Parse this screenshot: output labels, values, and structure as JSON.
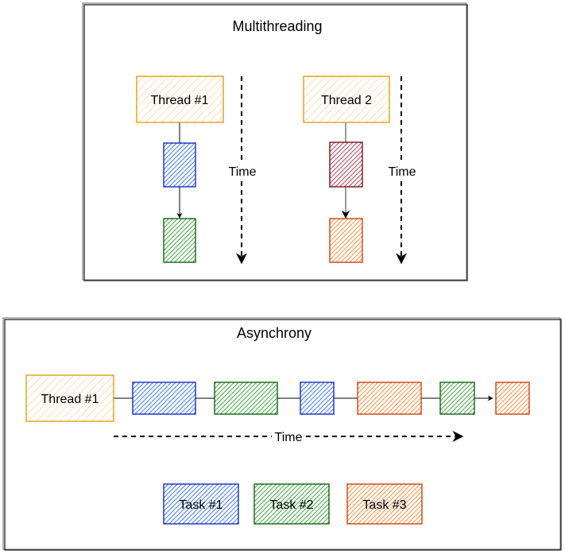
{
  "colors": {
    "thread": {
      "fill": "#FFE6CC",
      "stroke": "#D79B00"
    },
    "blue": {
      "fill": "#0050EF",
      "stroke": "#001DBC"
    },
    "green": {
      "fill": "#008A00",
      "stroke": "#005700"
    },
    "orange": {
      "fill": "#FA6800",
      "stroke": "#C73500"
    },
    "darkred": {
      "fill": "#A20025",
      "stroke": "#6F0000"
    }
  },
  "multithreading": {
    "title": "Multithreading",
    "thread1": "Thread #1",
    "thread2": "Thread 2",
    "time1": "Time",
    "time2": "Time"
  },
  "asynchrony": {
    "title": "Asynchrony",
    "thread": "Thread #1",
    "time": "Time",
    "sequence": [
      "blue",
      "green",
      "blue",
      "orange",
      "green",
      "orange"
    ],
    "legend": [
      {
        "label": "Task #1",
        "color": "blue"
      },
      {
        "label": "Task #2",
        "color": "green"
      },
      {
        "label": "Task #3",
        "color": "orange"
      }
    ]
  }
}
